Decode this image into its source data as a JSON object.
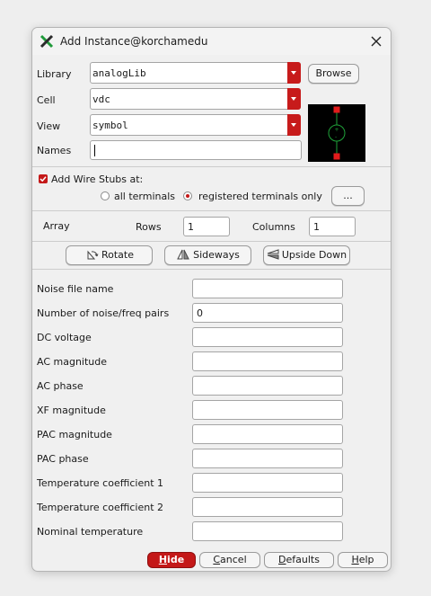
{
  "window": {
    "title": "Add Instance@korchamedu"
  },
  "fields": {
    "library": {
      "label": "Library",
      "value": "analogLib"
    },
    "cell": {
      "label": "Cell",
      "value": "vdc"
    },
    "view": {
      "label": "View",
      "value": "symbol"
    },
    "names": {
      "label": "Names",
      "value": ""
    }
  },
  "buttons": {
    "browse": "Browse",
    "ellipsis": "...",
    "rotate": "Rotate",
    "sideways": "Sideways",
    "upside_down": "Upside Down"
  },
  "wire_stubs": {
    "label": "Add Wire Stubs at:",
    "checked": true,
    "options": [
      "all terminals",
      "registered terminals only"
    ],
    "selected": "registered terminals only"
  },
  "array": {
    "label": "Array",
    "rows_label": "Rows",
    "rows_value": "1",
    "columns_label": "Columns",
    "columns_value": "1"
  },
  "params": [
    {
      "label": "Noise file name",
      "value": ""
    },
    {
      "label": "Number of noise/freq pairs",
      "value": "0"
    },
    {
      "label": "DC voltage",
      "value": ""
    },
    {
      "label": "AC magnitude",
      "value": ""
    },
    {
      "label": "AC phase",
      "value": ""
    },
    {
      "label": "XF magnitude",
      "value": ""
    },
    {
      "label": "PAC magnitude",
      "value": ""
    },
    {
      "label": "PAC phase",
      "value": ""
    },
    {
      "label": "Temperature coefficient 1",
      "value": ""
    },
    {
      "label": "Temperature coefficient 2",
      "value": ""
    },
    {
      "label": "Nominal temperature",
      "value": ""
    }
  ],
  "footer": {
    "hide_first": "H",
    "hide_rest": "ide",
    "cancel_first": "C",
    "cancel_rest": "ancel",
    "defaults_first": "D",
    "defaults_rest": "efaults",
    "help_first": "H",
    "help_rest": "elp"
  },
  "colors": {
    "accent": "#c41818",
    "preview_bg": "#000000",
    "symbol_green": "#1fa33a"
  }
}
